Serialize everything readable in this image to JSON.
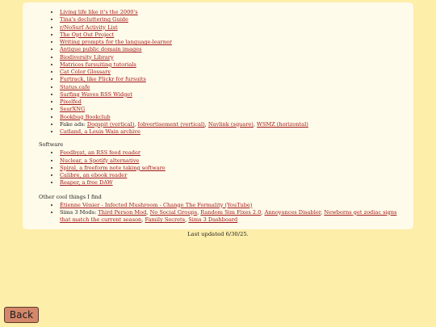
{
  "links": [
    "Living life like it's the 2000's",
    "Tina's decluttering Guide",
    "r/NoSurf Activity List",
    "The Opt Out Project",
    "Writing prompts for the language-learner",
    "Antique public domain images",
    "Biodiversity Library",
    "Matrices fursuiting tutorials",
    "Cat Color Glossary",
    "Furtrack, like Flickr for fursuits",
    "Status.cafe",
    "Surfing Waves RSS Widget",
    "Pixelfed",
    "SearXNG",
    "Bookbug Bookclub"
  ],
  "fake_ads": {
    "label": "Fake ads:",
    "items": [
      {
        "text": "Dogspit (vertical)",
        "sep": ", "
      },
      {
        "text": "Iobvertisement (vertical)",
        "sep": ", "
      },
      {
        "text": "Navlink (square)",
        "sep": ", "
      },
      {
        "text": "WSMZ (horizontal)",
        "sep": ""
      }
    ]
  },
  "catland": "Catland, a Louis Wain archive",
  "software": {
    "title": "Software",
    "items": [
      "Feedbyat, an RSS feed reader",
      "Nuclear, a Spotify alternative",
      "Spiral, a freeform note taking software",
      "Calibre, an ebook reader",
      "Reaper, a free DAW"
    ]
  },
  "other": {
    "title": "Other cool things I find",
    "video": "Étienne Vénier - Infected Mushroom - Change The Formality (YouTube)",
    "sims_label": "Sims 3 Mods:",
    "sims_mods": [
      {
        "text": "Third Person Mod",
        "sep": ", "
      },
      {
        "text": "No Social Groups",
        "sep": ", "
      },
      {
        "text": "Random Sim Fixes 2.0",
        "sep": ", "
      },
      {
        "text": "Annoyances Disabler",
        "sep": ", "
      },
      {
        "text": "Newborns get zodiac signs that match the current season",
        "sep": ", "
      },
      {
        "text": "Family Secrets",
        "sep": ", "
      },
      {
        "text": "Sims 3 Dashboard",
        "sep": ""
      }
    ]
  },
  "footer": {
    "updated": "Last updated 6/30/25."
  },
  "back_button": "Back",
  "colors": {
    "page_bg": "#fdeeaa",
    "card_bg": "#fffbea",
    "link": "#a01818",
    "button_bg": "#d4876a"
  }
}
